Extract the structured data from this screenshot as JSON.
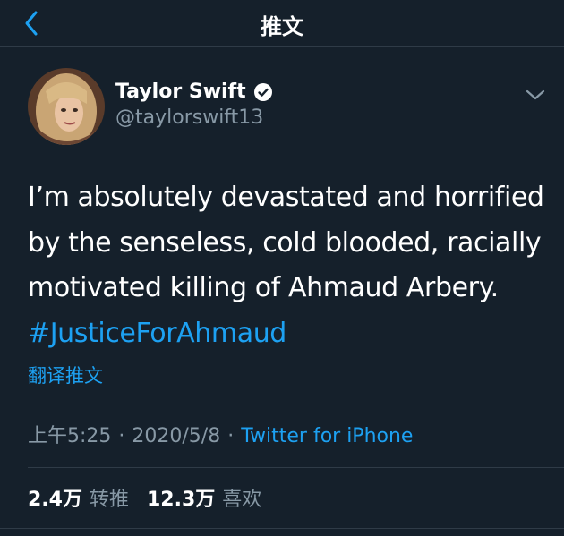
{
  "colors": {
    "background": "#15202b",
    "accent": "#1da1f2",
    "secondary_text": "#8899a6",
    "divider": "#2f3b47"
  },
  "navbar": {
    "back_icon": "chevron-left-icon",
    "title": "推文"
  },
  "author": {
    "name": "Taylor Swift",
    "handle": "@taylorswift13",
    "verified_icon": "verified-badge-icon",
    "avatar": "profile-photo"
  },
  "tweet": {
    "lines": [
      "I’m absolutely devastated and horrified",
      "by the senseless, cold blooded, racially",
      "motivated killing of Ahmaud Arbery."
    ],
    "hashtag": "#JusticeForAhmaud",
    "translate_label": "翻译推文"
  },
  "meta": {
    "time": "上午5:25",
    "separator": "·",
    "date": "2020/5/8",
    "source": "Twitter for iPhone"
  },
  "stats": {
    "retweets_count": "2.4万",
    "retweets_label": "转推",
    "likes_count": "12.3万",
    "likes_label": "喜欢"
  },
  "more_icon": "chevron-down-icon"
}
